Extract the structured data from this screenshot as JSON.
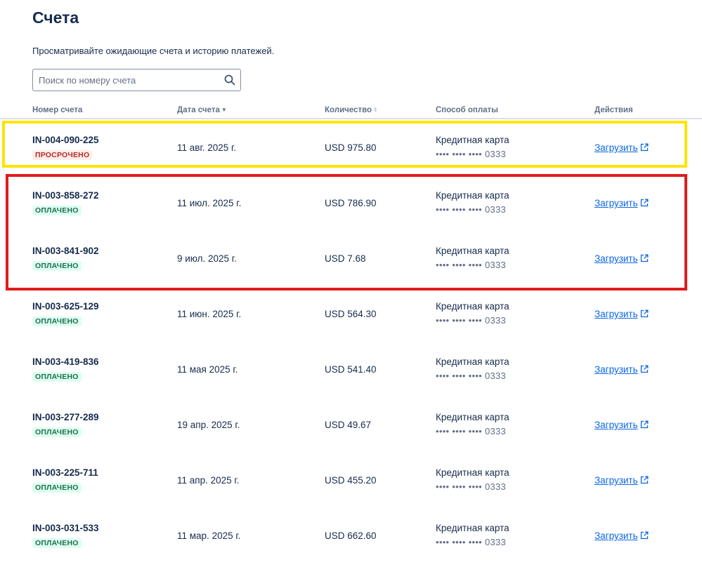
{
  "page": {
    "title": "Счета",
    "subtitle": "Просматривайте ожидающие счета и историю платежей."
  },
  "search": {
    "placeholder": "Поиск по номеру счета",
    "value": "",
    "icon": "search-icon"
  },
  "table": {
    "columns": {
      "invoice_number": "Номер счета",
      "invoice_date": "Дата счета",
      "amount": "Количество",
      "payment_method": "Способ оплаты",
      "actions": "Действия"
    },
    "rows": [
      {
        "id": "IN-004-090-225",
        "status": "ПРОСРОЧЕНО",
        "status_type": "overdue",
        "date": "11 авг. 2025 г.",
        "amount": "USD 975.80",
        "method": "Кредитная карта",
        "card": "•••• •••• •••• 0333",
        "action": "Загрузить"
      },
      {
        "id": "IN-003-858-272",
        "status": "ОПЛАЧЕНО",
        "status_type": "paid",
        "date": "11 июл. 2025 г.",
        "amount": "USD 786.90",
        "method": "Кредитная карта",
        "card": "•••• •••• •••• 0333",
        "action": "Загрузить"
      },
      {
        "id": "IN-003-841-902",
        "status": "ОПЛАЧЕНО",
        "status_type": "paid",
        "date": "9 июл. 2025 г.",
        "amount": "USD 7.68",
        "method": "Кредитная карта",
        "card": "•••• •••• •••• 0333",
        "action": "Загрузить"
      },
      {
        "id": "IN-003-625-129",
        "status": "ОПЛАЧЕНО",
        "status_type": "paid",
        "date": "11 июн. 2025 г.",
        "amount": "USD 564.30",
        "method": "Кредитная карта",
        "card": "•••• •••• •••• 0333",
        "action": "Загрузить"
      },
      {
        "id": "IN-003-419-836",
        "status": "ОПЛАЧЕНО",
        "status_type": "paid",
        "date": "11 мая 2025 г.",
        "amount": "USD 541.40",
        "method": "Кредитная карта",
        "card": "•••• •••• •••• 0333",
        "action": "Загрузить"
      },
      {
        "id": "IN-003-277-289",
        "status": "ОПЛАЧЕНО",
        "status_type": "paid",
        "date": "19 апр. 2025 г.",
        "amount": "USD 49.67",
        "method": "Кредитная карта",
        "card": "•••• •••• •••• 0333",
        "action": "Загрузить"
      },
      {
        "id": "IN-003-225-711",
        "status": "ОПЛАЧЕНО",
        "status_type": "paid",
        "date": "11 апр. 2025 г.",
        "amount": "USD 455.20",
        "method": "Кредитная карта",
        "card": "•••• •••• •••• 0333",
        "action": "Загрузить"
      },
      {
        "id": "IN-003-031-533",
        "status": "ОПЛАЧЕНО",
        "status_type": "paid",
        "date": "11 мар. 2025 г.",
        "amount": "USD 662.60",
        "method": "Кредитная карта",
        "card": "•••• •••• •••• 0333",
        "action": "Загрузить"
      }
    ]
  },
  "colors": {
    "link": "#0c66e4",
    "overdue_bg": "#ffeceb",
    "overdue_text": "#ae2e24",
    "paid_bg": "#dcfff1",
    "paid_text": "#216e4e",
    "highlight_yellow": "#ffe400",
    "highlight_red": "#e01b1b"
  }
}
